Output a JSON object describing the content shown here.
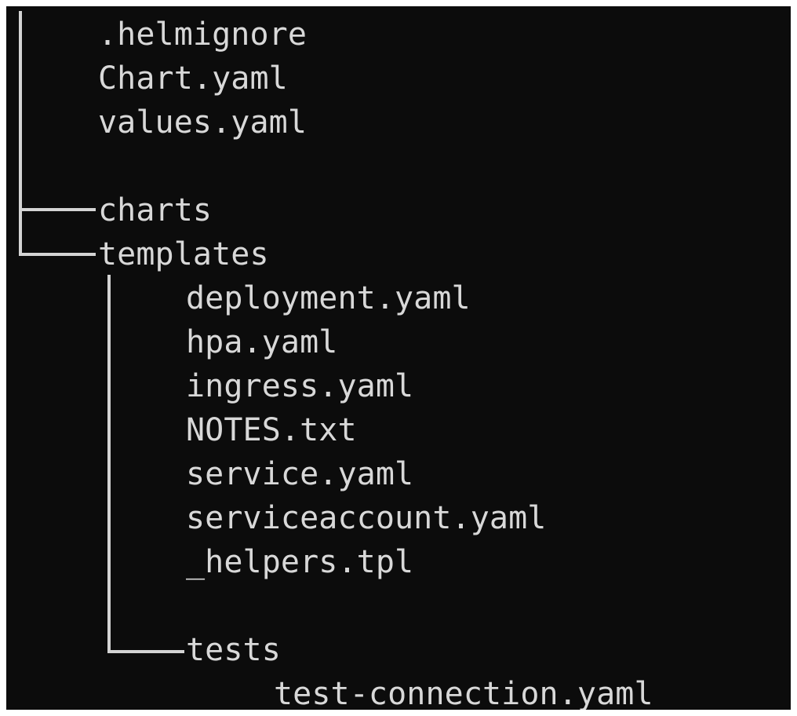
{
  "terminal": {
    "background": "#0c0c0c",
    "foreground": "#d8d8d8"
  },
  "tree": {
    "root_files": [
      ".helmignore",
      "Chart.yaml",
      "values.yaml"
    ],
    "folders": {
      "charts": "charts",
      "templates": "templates",
      "tests": "tests"
    },
    "template_files": [
      "deployment.yaml",
      "hpa.yaml",
      "ingress.yaml",
      "NOTES.txt",
      "service.yaml",
      "serviceaccount.yaml",
      "_helpers.tpl"
    ],
    "test_files": [
      "test-connection.yaml"
    ]
  }
}
